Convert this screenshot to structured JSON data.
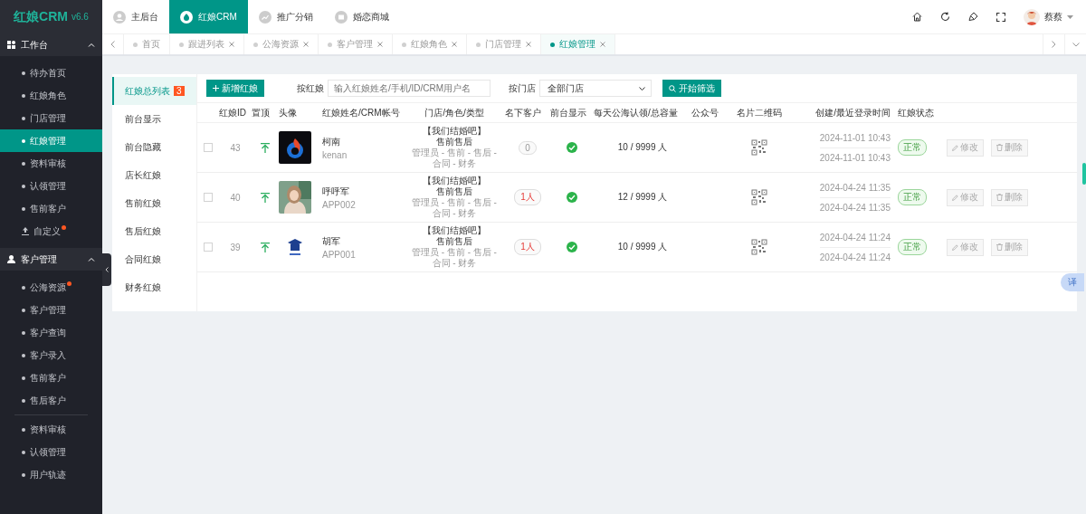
{
  "brand": {
    "name": "红娘CRM",
    "version": "v6.6"
  },
  "sidebar": {
    "groups": [
      {
        "title": "工作台",
        "expanded": true,
        "items": [
          {
            "label": "待办首页",
            "selected": false,
            "dot": false
          },
          {
            "label": "红娘角色",
            "selected": false,
            "dot": false
          },
          {
            "label": "门店管理",
            "selected": false,
            "dot": false
          },
          {
            "label": "红娘管理",
            "selected": true,
            "dot": false
          },
          {
            "label": "资料审核",
            "selected": false,
            "dot": false
          },
          {
            "label": "认领管理",
            "selected": false,
            "dot": false
          },
          {
            "label": "售前客户",
            "selected": false,
            "dot": false
          },
          {
            "label": "自定义",
            "selected": false,
            "dot": true,
            "kind": "upload"
          }
        ]
      },
      {
        "title": "客户管理",
        "expanded": true,
        "items": [
          {
            "label": "公海资源",
            "selected": false,
            "dot": true
          },
          {
            "label": "客户管理",
            "selected": false,
            "dot": false
          },
          {
            "label": "客户查询",
            "selected": false,
            "dot": false
          },
          {
            "label": "客户录入",
            "selected": false,
            "dot": false
          },
          {
            "label": "售前客户",
            "selected": false,
            "dot": false
          },
          {
            "label": "售后客户",
            "selected": false,
            "dot": false,
            "divider_after": true
          },
          {
            "label": "资料审核",
            "selected": false,
            "dot": false
          },
          {
            "label": "认领管理",
            "selected": false,
            "dot": false
          },
          {
            "label": "用户轨迹",
            "selected": false,
            "dot": false
          }
        ]
      }
    ]
  },
  "top_nav": [
    {
      "label": "主后台",
      "selected": false
    },
    {
      "label": "红娘CRM",
      "selected": true
    },
    {
      "label": "推广分销",
      "selected": false
    },
    {
      "label": "婚恋商城",
      "selected": false
    }
  ],
  "user": {
    "name": "蔡蔡"
  },
  "tabs": [
    {
      "label": "首页",
      "selected": false,
      "closable": false
    },
    {
      "label": "跟进列表",
      "selected": false,
      "closable": true
    },
    {
      "label": "公海资源",
      "selected": false,
      "closable": true
    },
    {
      "label": "客户管理",
      "selected": false,
      "closable": true
    },
    {
      "label": "红娘角色",
      "selected": false,
      "closable": true
    },
    {
      "label": "门店管理",
      "selected": false,
      "closable": true
    },
    {
      "label": "红娘管理",
      "selected": true,
      "closable": true
    }
  ],
  "sub_nav": [
    {
      "label": "红娘总列表",
      "selected": true,
      "badge": "3"
    },
    {
      "label": "前台显示",
      "selected": false
    },
    {
      "label": "前台隐藏",
      "selected": false
    },
    {
      "label": "店长红娘",
      "selected": false
    },
    {
      "label": "售前红娘",
      "selected": false
    },
    {
      "label": "售后红娘",
      "selected": false
    },
    {
      "label": "合同红娘",
      "selected": false
    },
    {
      "label": "财务红娘",
      "selected": false
    }
  ],
  "toolbar": {
    "add_button": "新增红娘",
    "search_label": "按红娘",
    "search_placeholder": "输入红娘姓名/手机/ID/CRM用户名",
    "store_label": "按门店",
    "store_value": "全部门店",
    "filter_button": "开始筛选"
  },
  "table": {
    "columns": [
      "红娘ID",
      "置顶",
      "头像",
      "红娘姓名/CRM帐号",
      "门店/角色/类型",
      "名下客户",
      "前台显示",
      "每天公海认领/总容量",
      "公众号",
      "名片二维码",
      "创建/最近登录时间",
      "红娘状态"
    ],
    "rows": [
      {
        "checked": false,
        "id": "43",
        "name": "柯南",
        "account": "kenan",
        "store": "【我们结婚吧】",
        "type": "售前售后",
        "roles": "管理员 - 售前 - 售后 - 合同 - 财务",
        "customers": "0",
        "has_customers": false,
        "front_display": true,
        "quota": "10 / 9999 人",
        "created": "2024-11-01 10:43",
        "last_login": "2024-11-01 10:43",
        "status": "正常",
        "edit": "修改",
        "delete": "删除"
      },
      {
        "checked": false,
        "id": "40",
        "name": "呼呼军",
        "account": "APP002",
        "store": "【我们结婚吧】",
        "type": "售前售后",
        "roles": "管理员 - 售前 - 售后 - 合同 - 财务",
        "customers": "1人",
        "has_customers": true,
        "front_display": true,
        "quota": "12 / 9999 人",
        "created": "2024-04-24 11:35",
        "last_login": "2024-04-24 11:35",
        "status": "正常",
        "edit": "修改",
        "delete": "删除"
      },
      {
        "checked": false,
        "id": "39",
        "name": "胡军",
        "account": "APP001",
        "store": "【我们结婚吧】",
        "type": "售前售后",
        "roles": "管理员 - 售前 - 售后 - 合同 - 财务",
        "customers": "1人",
        "has_customers": true,
        "front_display": true,
        "quota": "10 / 9999 人",
        "created": "2024-04-24 11:24",
        "last_login": "2024-04-24 11:24",
        "status": "正常",
        "edit": "修改",
        "delete": "删除"
      }
    ]
  },
  "translate_button": "译"
}
